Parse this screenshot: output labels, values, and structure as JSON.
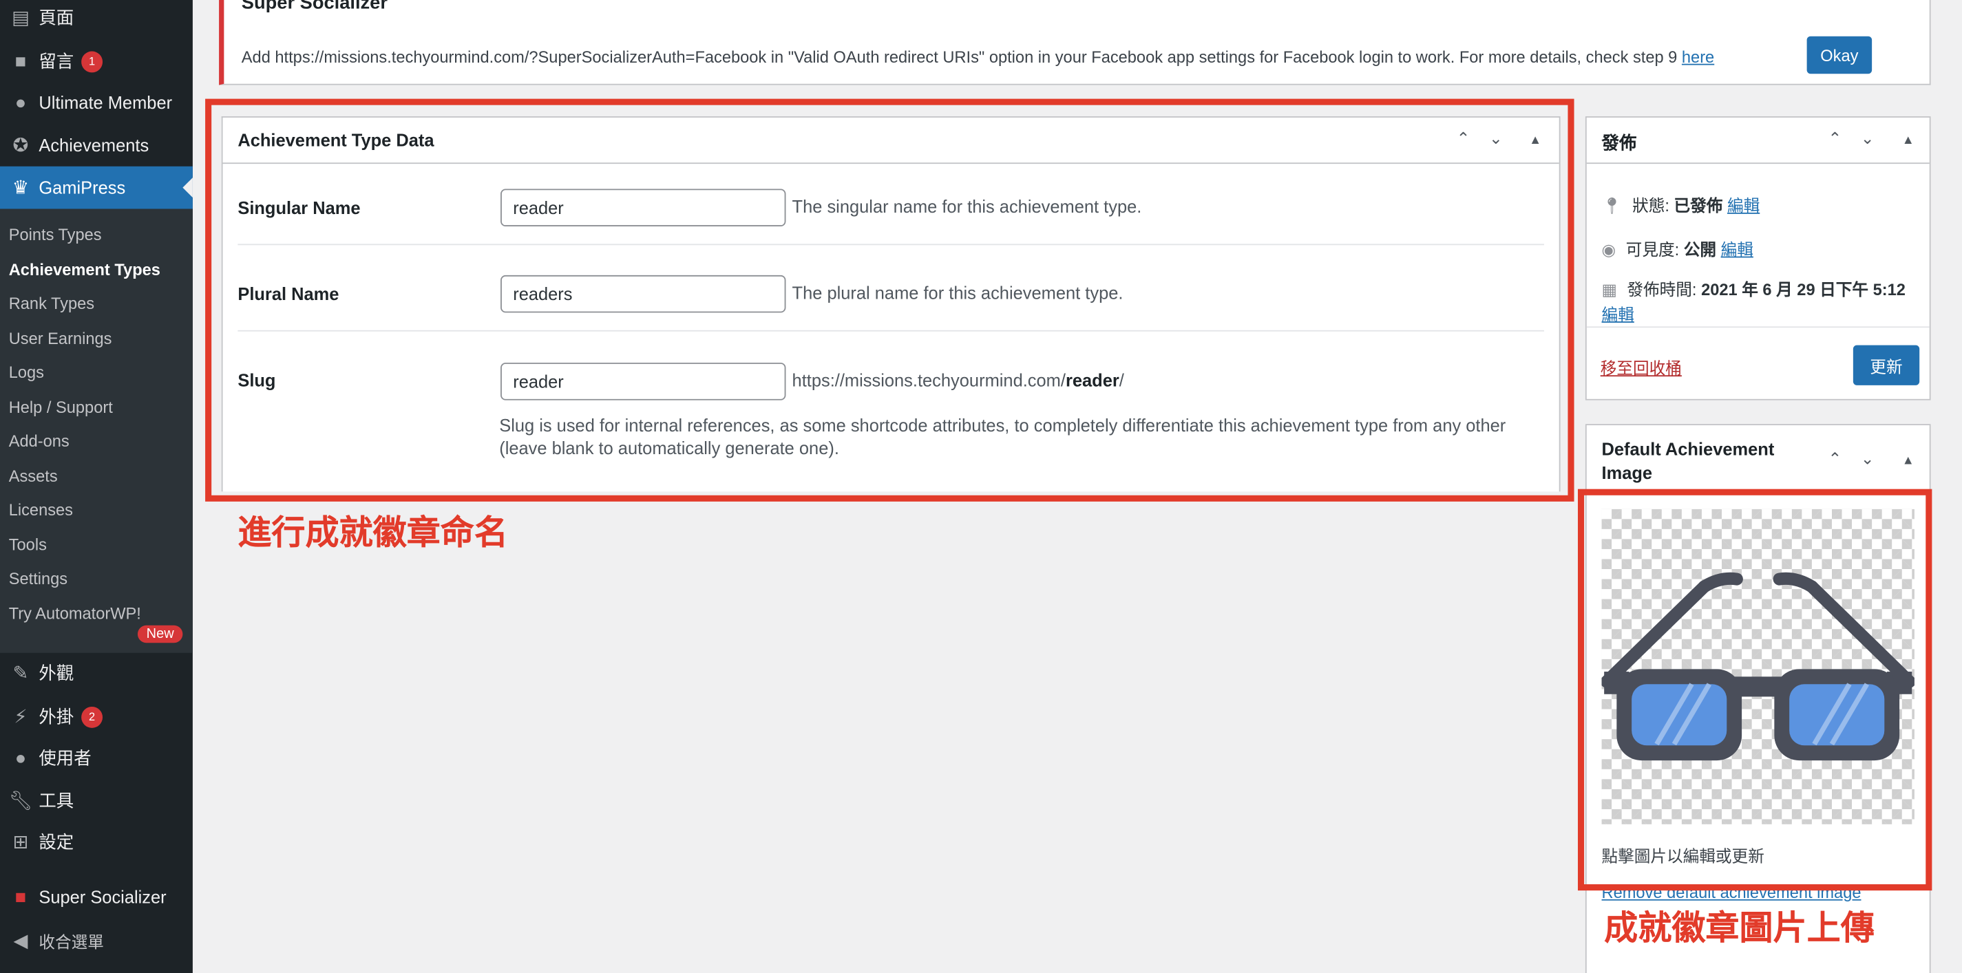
{
  "sidebar": {
    "top_items": [
      {
        "label": "頁面",
        "icon": "pages-icon"
      },
      {
        "label": "留言",
        "icon": "comments-icon",
        "badge": "1"
      },
      {
        "label": "Ultimate Member",
        "icon": "user-icon"
      },
      {
        "label": "Achievements",
        "icon": "award-icon"
      },
      {
        "label": "GamiPress",
        "icon": "crown-icon"
      }
    ],
    "sub_items": [
      "Points Types",
      "Achievement Types",
      "Rank Types",
      "User Earnings",
      "Logs",
      "Help / Support",
      "Add-ons",
      "Assets",
      "Licenses",
      "Tools",
      "Settings",
      "Try AutomatorWP!"
    ],
    "new_badge": "New",
    "bottom_items": [
      {
        "label": "外觀",
        "icon": "appearance-icon"
      },
      {
        "label": "外掛",
        "icon": "plugins-icon",
        "badge": "2"
      },
      {
        "label": "使用者",
        "icon": "users-icon"
      },
      {
        "label": "工具",
        "icon": "tools-icon"
      },
      {
        "label": "設定",
        "icon": "settings-icon"
      },
      {
        "label": "Super Socializer",
        "icon": "super-socializer-icon"
      },
      {
        "label": "收合選單",
        "icon": "collapse-icon"
      }
    ]
  },
  "notice": {
    "title": "Super Socializer",
    "text": "Add https://missions.techyourmind.com/?SuperSocializerAuth=Facebook in \"Valid OAuth redirect URIs\" option in your Facebook app settings for Facebook login to work. For more details, check step 9 ",
    "link": "here",
    "button": "Okay"
  },
  "achievement_box": {
    "title": "Achievement Type Data",
    "singular_label": "Singular Name",
    "singular_value": "reader",
    "singular_desc": "The singular name for this achievement type.",
    "plural_label": "Plural Name",
    "plural_value": "readers",
    "plural_desc": "The plural name for this achievement type.",
    "slug_label": "Slug",
    "slug_value": "reader",
    "slug_url_prefix": "https://missions.techyourmind.com/",
    "slug_url_bold": "reader",
    "slug_url_suffix": "/",
    "slug_desc": "Slug is used for internal references, as some shortcode attributes, to completely differentiate this achievement type from any other (leave blank to automatically generate one)."
  },
  "annotation_left": "進行成就徽章命名",
  "annotation_right": "成就徽章圖片上傳",
  "publish_box": {
    "title": "發佈",
    "status_label": "狀態: ",
    "status_value": "已發佈",
    "visibility_label": "可見度: ",
    "visibility_value": "公開",
    "date_label": "發佈時間: ",
    "date_value": "2021 年 6 月 29 日下午 5:12",
    "edit": "編輯",
    "trash": "移至回收桶",
    "update": "更新"
  },
  "image_box": {
    "title": "Default Achievement Image",
    "hint": "點擊圖片以編輯或更新",
    "remove": "Remove default achievement image"
  }
}
